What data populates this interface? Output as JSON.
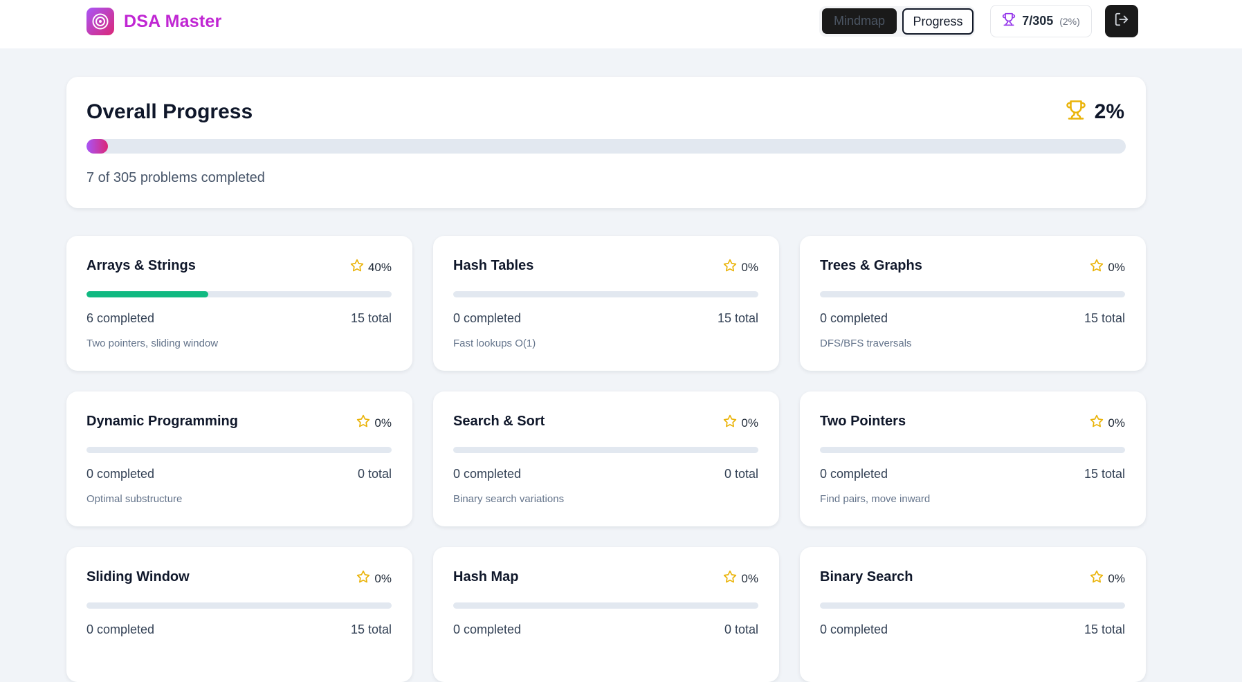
{
  "app": {
    "title": "DSA Master",
    "accent_gradient": [
      "#a855f7",
      "#db2777"
    ]
  },
  "header": {
    "view_toggle": {
      "mindmap_label": "Mindmap",
      "progress_label": "Progress",
      "active": "Progress"
    },
    "stats": {
      "count": "7/305",
      "percent": "(2%)"
    },
    "icons": {
      "brand": "target-icon",
      "stats": "trophy-icon",
      "logout": "logout-icon"
    }
  },
  "overall": {
    "title": "Overall Progress",
    "percent_label": "2%",
    "percent_value": 2,
    "subtitle": "7 of 305 problems completed",
    "icon": "trophy-icon",
    "icon_color": "#eab308"
  },
  "categories": [
    {
      "title": "Arrays & Strings",
      "percent": "40%",
      "progress": 0.4,
      "completed": "6 completed",
      "total": "15 total",
      "description": "Two pointers, sliding window"
    },
    {
      "title": "Hash Tables",
      "percent": "0%",
      "progress": 0,
      "completed": "0 completed",
      "total": "15 total",
      "description": "Fast lookups O(1)"
    },
    {
      "title": "Trees & Graphs",
      "percent": "0%",
      "progress": 0,
      "completed": "0 completed",
      "total": "15 total",
      "description": "DFS/BFS traversals"
    },
    {
      "title": "Dynamic Programming",
      "percent": "0%",
      "progress": 0,
      "completed": "0 completed",
      "total": "0 total",
      "description": "Optimal substructure"
    },
    {
      "title": "Search & Sort",
      "percent": "0%",
      "progress": 0,
      "completed": "0 completed",
      "total": "0 total",
      "description": "Binary search variations"
    },
    {
      "title": "Two Pointers",
      "percent": "0%",
      "progress": 0,
      "completed": "0 completed",
      "total": "15 total",
      "description": "Find pairs, move inward"
    },
    {
      "title": "Sliding Window",
      "percent": "0%",
      "progress": 0,
      "completed": "0 completed",
      "total": "15 total",
      "description": ""
    },
    {
      "title": "Hash Map",
      "percent": "0%",
      "progress": 0,
      "completed": "0 completed",
      "total": "0 total",
      "description": ""
    },
    {
      "title": "Binary Search",
      "percent": "0%",
      "progress": 0,
      "completed": "0 completed",
      "total": "15 total",
      "description": ""
    }
  ],
  "colors": {
    "card_progress": "#10b981",
    "star": "#eab308",
    "track": "#e2e8f0"
  }
}
